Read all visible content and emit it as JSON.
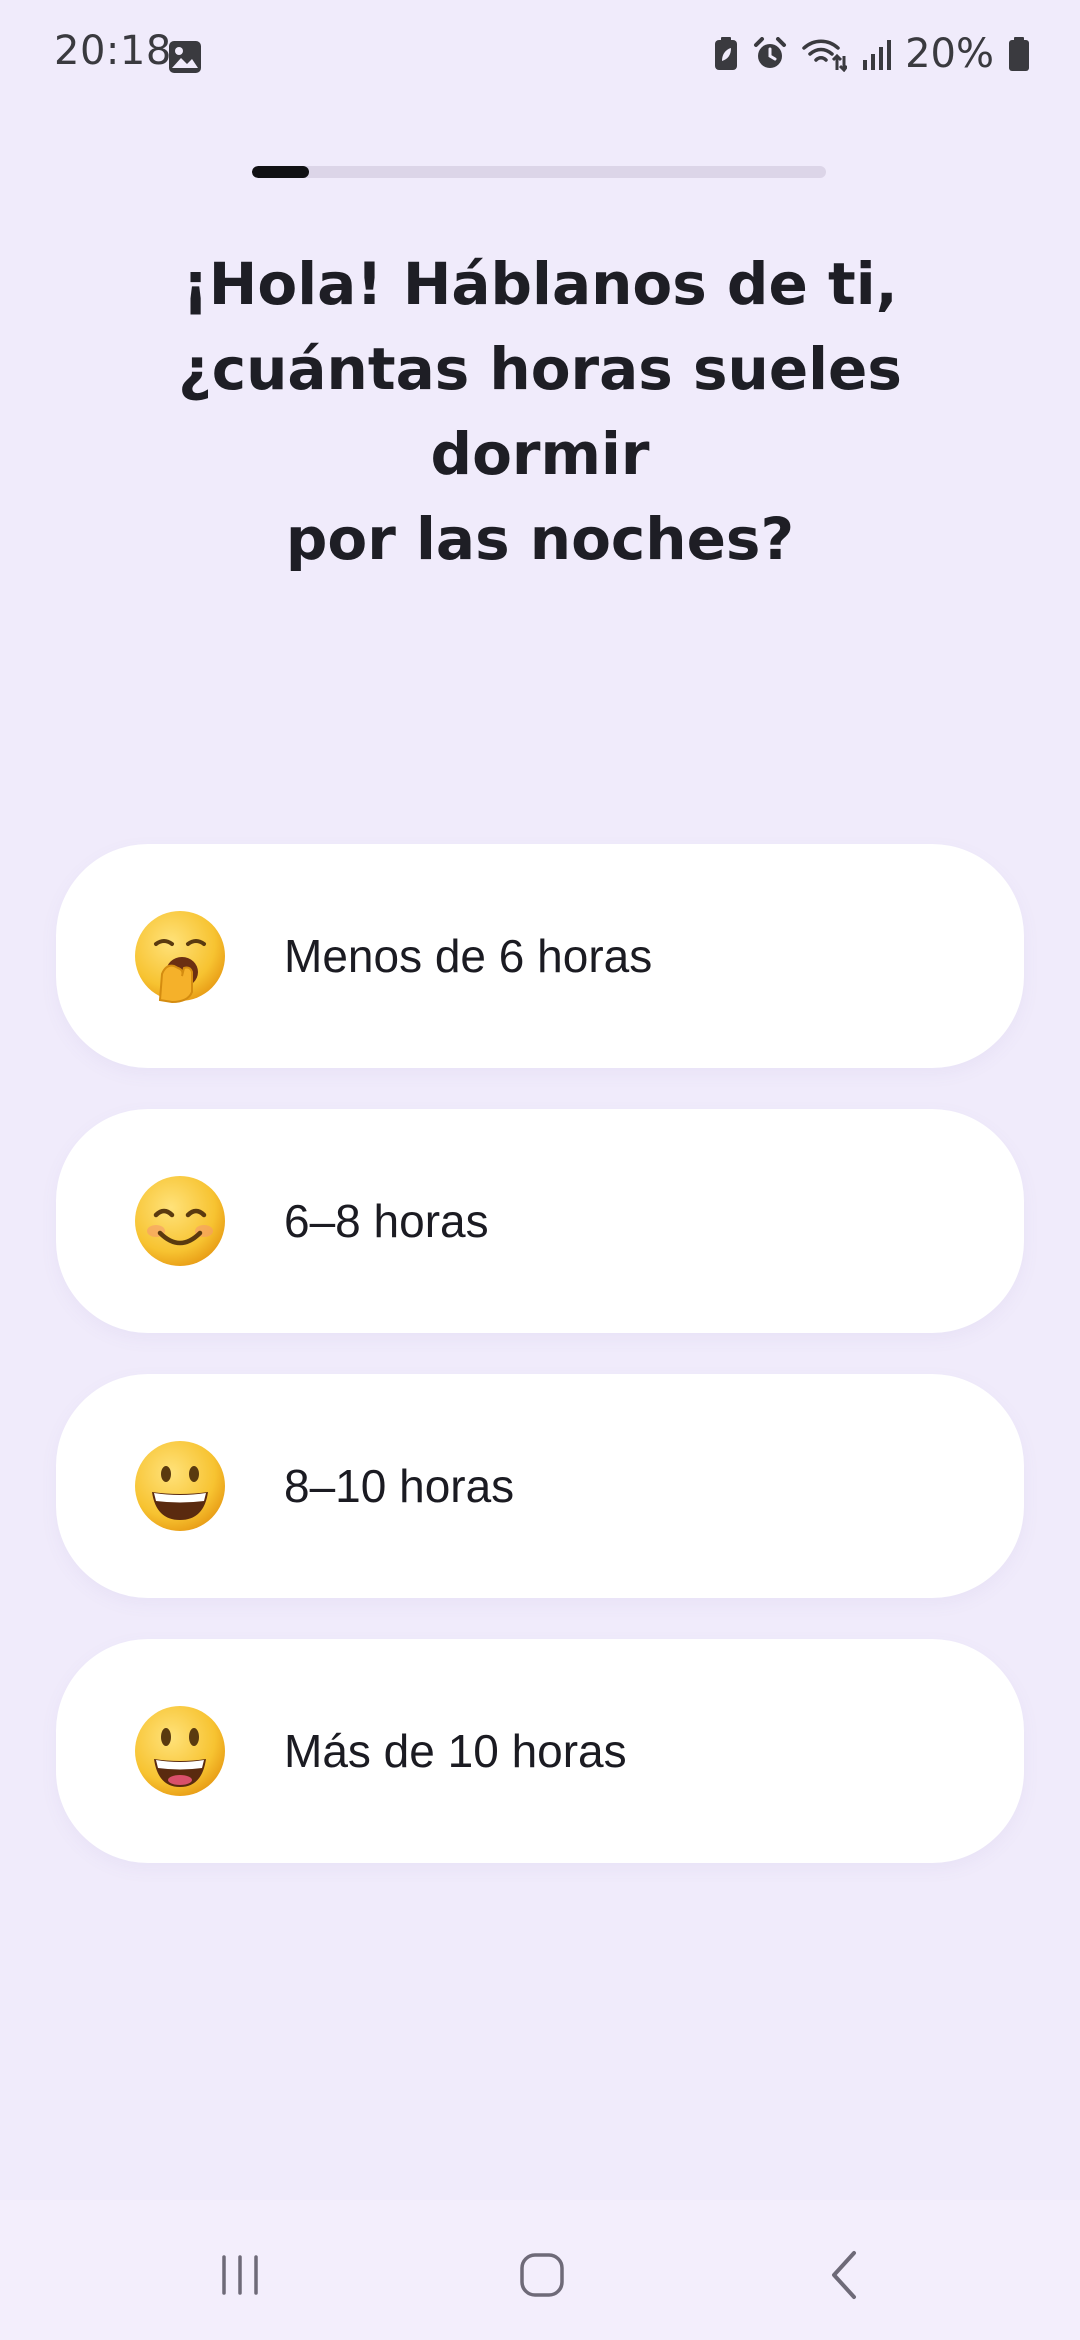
{
  "status_bar": {
    "time": "20:18",
    "battery_percent": "20%",
    "icons": [
      "gallery-icon",
      "battery-saver-icon",
      "alarm-icon",
      "wifi-icon",
      "signal-icon",
      "battery-icon"
    ]
  },
  "progress": {
    "value": 0.1
  },
  "question": {
    "line1": "¡Hola! Háblanos de ti,",
    "line2": "¿cuántas horas sueles dormir",
    "line3": "por las noches?"
  },
  "options": [
    {
      "label": "Menos de 6 horas",
      "emoji": "yawning-face"
    },
    {
      "label": "6–8 horas",
      "emoji": "smiling-face-with-smiling-eyes"
    },
    {
      "label": "8–10 horas",
      "emoji": "grinning-face"
    },
    {
      "label": "Más de 10 horas",
      "emoji": "smiling-face-with-open-mouth"
    }
  ],
  "nav_bar": {
    "buttons": [
      "recent-apps-icon",
      "home-icon",
      "back-icon"
    ]
  },
  "colors": {
    "background": "#f0ebfb",
    "card": "#ffffff",
    "progress_fill": "#111114",
    "progress_track": "#dcd5e8",
    "emoji_yellow": "#f7c331"
  }
}
